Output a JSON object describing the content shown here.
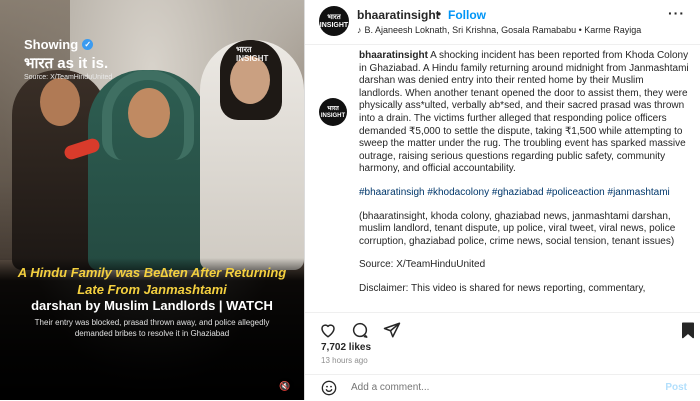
{
  "media": {
    "watermark_line1": "Showing",
    "watermark_line2": "भारत as it is.",
    "watermark_source": "Source: X/TeamHinduUnited",
    "brand_mini_line1": "भारत",
    "brand_mini_line2": "INSIGHT",
    "headline_yellow": "A Hindu Family was Be∆ten After Returning Late From Janmashtami",
    "headline_white": "darshan by Muslim Landlords | WATCH",
    "subtext": "Their entry was blocked, prasad thrown away, and police allegedly demanded bribes to resolve it in Ghaziabad",
    "mute_icon": "speaker-muted-icon"
  },
  "header": {
    "avatar_line1": "भारत",
    "avatar_line2": "INSIGHT",
    "username": "bhaaratinsight",
    "dot": "•",
    "follow_label": "Follow",
    "more_label": "···",
    "audio_text": "B. Ajaneesh Loknath, Sri Krishna, Gosala Ramababu • Karme Rayiga"
  },
  "post": {
    "username": "bhaaratinsight",
    "caption": "A shocking incident has been reported from Khoda Colony in Ghaziabad. A Hindu family returning around midnight from Janmashtami darshan was denied entry into their rented home by their Muslim landlords. When another tenant opened the door to assist them, they were physically ass*ulted, verbally ab*sed, and their sacred prasad was thrown into a drain. The victims further alleged that responding police officers demanded ₹5,000 to settle the dispute, taking ₹1,500 while attempting to sweep the matter under the rug. The troubling event has sparked massive outrage, raising serious questions regarding public safety, community harmony, and official accountability.",
    "hashtags": "#bhaaratinsigh #khodacolony #ghaziabad #policeaction #janmashtami",
    "keywords": "(bhaaratinsight, khoda colony, ghaziabad news, janmashtami darshan, muslim landlord, tenant dispute, up police, viral tweet, viral news, police corruption, ghaziabad police, crime news, social tension, tenant issues)",
    "source": "Source: X/TeamHinduUnited",
    "disclaimer": "Disclaimer: This video is shared for news reporting, commentary,"
  },
  "footer": {
    "likes": "7,702 likes",
    "time": "13 hours ago",
    "comment_placeholder": "Add a comment...",
    "post_label": "Post"
  },
  "colors": {
    "accent": "#0095f6",
    "headline_yellow": "#f4d03f",
    "hashtag": "#00376b"
  }
}
